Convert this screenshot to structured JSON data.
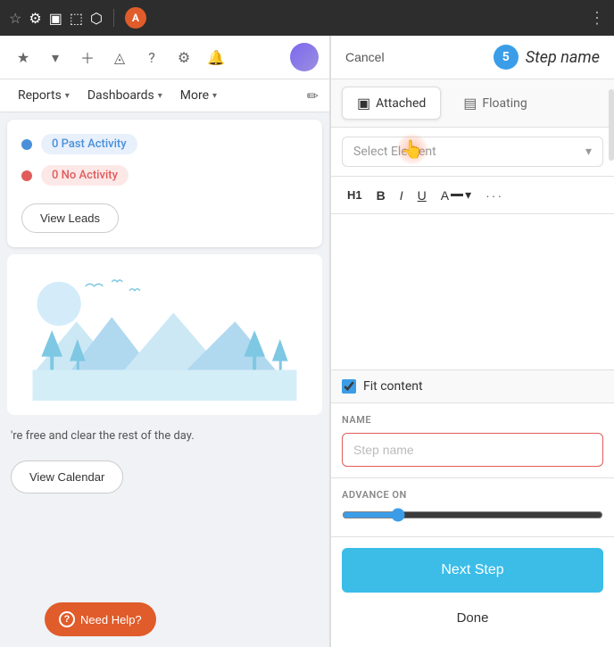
{
  "browser": {
    "avatar_letter": "A"
  },
  "nav": {
    "reports_label": "Reports",
    "dashboards_label": "Dashboards",
    "more_label": "More"
  },
  "stats": {
    "past_activity_label": "0 Past Activity",
    "no_activity_label": "0 No Activity",
    "view_leads_label": "View Leads"
  },
  "bottom": {
    "free_text": "'re free and clear the rest of the day.",
    "view_calendar_label": "View Calendar",
    "need_help_label": "Need Help?"
  },
  "panel": {
    "cancel_label": "Cancel",
    "step_number": "5",
    "step_name": "Step name",
    "tabs": {
      "attached_label": "Attached",
      "floating_label": "Floating"
    },
    "select_placeholder": "Select Element",
    "text_tools": {
      "h1": "H1",
      "bold": "B",
      "italic": "I",
      "underline": "U",
      "color": "A",
      "more": "···"
    },
    "fit_content_label": "Fit content",
    "name_section_label": "NAME",
    "name_placeholder": "Step name",
    "advance_section_label": "ADVANCE ON",
    "next_step_label": "Next Step",
    "done_label": "Done"
  }
}
